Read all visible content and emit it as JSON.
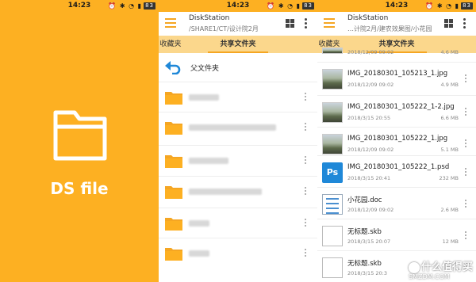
{
  "status_bar": {
    "time": "14:23",
    "battery": "83"
  },
  "splash": {
    "app_name": "DS file"
  },
  "panel2": {
    "title": "DiskStation",
    "path": "/SHARE1/CT/设计院2月",
    "tabs": [
      "收藏夹",
      "共享文件夹"
    ],
    "active_tab": 1,
    "parent_label": "父文件夹"
  },
  "panel3": {
    "title": "DiskStation",
    "path": "…计院2月/建农效果图/小花园",
    "tabs": [
      "收藏夹",
      "共享文件夹"
    ],
    "active_tab": 1,
    "top_partial": {
      "date": "2018/12/09 09:02",
      "size": "4.6 MB"
    },
    "files": [
      {
        "name": "IMG_20180301_105213_1.jpg",
        "date": "2018/12/09 09:02",
        "size": "4.9 MB",
        "type": "photo"
      },
      {
        "name": "IMG_20180301_105222_1-2.jpg",
        "date": "2018/3/15 20:55",
        "size": "6.6 MB",
        "type": "photo"
      },
      {
        "name": "IMG_20180301_105222_1.jpg",
        "date": "2018/12/09 09:02",
        "size": "5.1 MB",
        "type": "photo"
      },
      {
        "name": "IMG_20180301_105222_1.psd",
        "date": "2018/3/15 20:41",
        "size": "232 MB",
        "type": "psd"
      },
      {
        "name": "小花园.doc",
        "date": "2018/12/09 09:02",
        "size": "2.6 MB",
        "type": "doc"
      },
      {
        "name": "无标题.skb",
        "date": "2018/3/15 20:07",
        "size": "12 MB",
        "type": "skb"
      },
      {
        "name": "无标题.skb",
        "date": "2018/3/15 20:3",
        "size": "",
        "type": "skb"
      }
    ]
  },
  "watermark": {
    "line1": "什么值得买",
    "line2": "SMZDM.COM"
  },
  "colors": {
    "accent": "#fdb022",
    "tab_bg": "#fbd78c",
    "ps_blue": "#1f88d8"
  }
}
